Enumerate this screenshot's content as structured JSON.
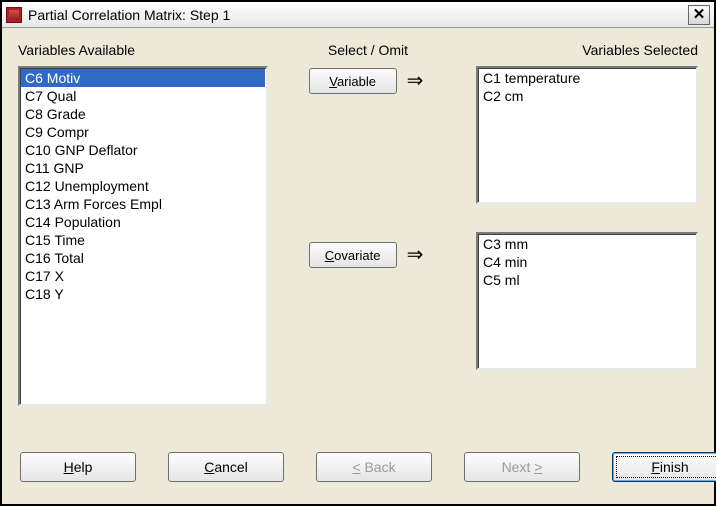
{
  "title": "Partial Correlation Matrix: Step 1",
  "labels": {
    "available": "Variables Available",
    "selectomit": "Select / Omit",
    "selected": "Variables Selected"
  },
  "buttons": {
    "variable_pre": "",
    "variable_ul": "V",
    "variable_post": "ariable",
    "covariate_pre": "",
    "covariate_ul": "C",
    "covariate_post": "ovariate",
    "help_pre": "",
    "help_ul": "H",
    "help_post": "elp",
    "cancel_pre": "",
    "cancel_ul": "C",
    "cancel_post": "ancel",
    "back_pre": "",
    "back_ul": "<",
    "back_post": " Back",
    "next_pre": "Next ",
    "next_ul": ">",
    "next_post": "",
    "finish_pre": "",
    "finish_ul": "F",
    "finish_post": "inish"
  },
  "available": [
    "C6 Motiv",
    "C7 Qual",
    "C8 Grade",
    "C9 Compr",
    "C10 GNP Deflator",
    "C11 GNP",
    "C12 Unemployment",
    "C13 Arm Forces Empl",
    "C14 Population",
    "C15 Time",
    "C16 Total",
    "C17 X",
    "C18 Y"
  ],
  "available_selected_index": 0,
  "selected_vars": [
    "C1 temperature",
    "C2 cm"
  ],
  "covariates": [
    "C3 mm",
    "C4 min",
    "C5 ml"
  ],
  "arrow": "⇒"
}
